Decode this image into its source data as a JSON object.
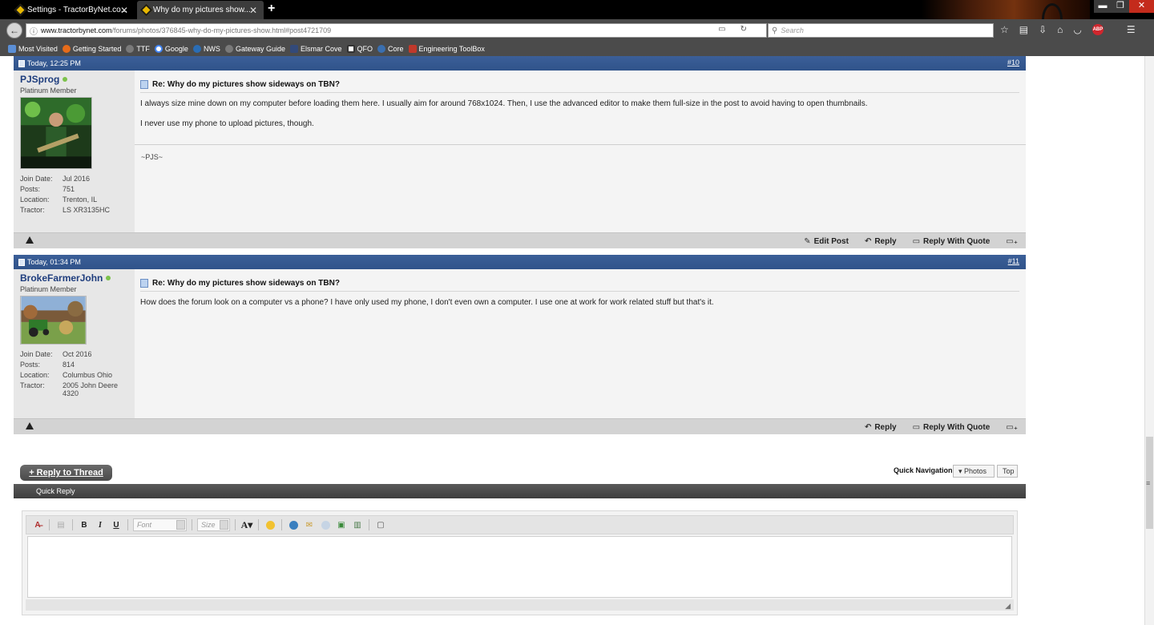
{
  "browser": {
    "tabs": [
      {
        "title": "Settings - TractorByNet.co..."
      },
      {
        "title": "Why do my pictures show..."
      }
    ],
    "url_domain": "www.tractorbynet.com",
    "url_path": "/forums/photos/376845-why-do-my-pictures-show.html#post4721709",
    "search_placeholder": "Search",
    "bookmarks": [
      {
        "label": "Most Visited",
        "color": "#5b8fd6"
      },
      {
        "label": "Getting Started",
        "color": "#e66b1a"
      },
      {
        "label": "TTF",
        "color": "#7a7a7a"
      },
      {
        "label": "Google",
        "color": "#4285f4"
      },
      {
        "label": "NWS",
        "color": "#2a6db5"
      },
      {
        "label": "Gateway Guide",
        "color": "#7a7a7a"
      },
      {
        "label": "Elsmar Cove",
        "color": "#334a7a"
      },
      {
        "label": "QFO",
        "color": "#ffffff"
      },
      {
        "label": "Core",
        "color": "#3a6fb0"
      },
      {
        "label": "Engineering ToolBox",
        "color": "#c0392b"
      }
    ]
  },
  "posts": [
    {
      "date": "Today, 12:25 PM",
      "number": "#10",
      "username": "PJSprog",
      "user_title": "Platinum Member",
      "info": [
        {
          "k": "Join Date:",
          "v": "Jul 2016"
        },
        {
          "k": "Posts:",
          "v": "751"
        },
        {
          "k": "Location:",
          "v": "Trenton, IL"
        },
        {
          "k": "Tractor:",
          "v": "LS XR3135HC"
        }
      ],
      "title": "Re: Why do my pictures show sideways on TBN?",
      "paragraphs": [
        "I always size mine down on my computer before loading them here. I usually aim for around 768x1024. Then, I use the advanced editor to make them full-size in the post to avoid having to open thumbnails.",
        "I never use my phone to upload pictures, though."
      ],
      "signature": "~PJS~",
      "actions": {
        "edit": "Edit Post",
        "reply": "Reply",
        "quote": "Reply With Quote"
      }
    },
    {
      "date": "Today, 01:34 PM",
      "number": "#11",
      "username": "BrokeFarmerJohn",
      "user_title": "Platinum Member",
      "info": [
        {
          "k": "Join Date:",
          "v": "Oct 2016"
        },
        {
          "k": "Posts:",
          "v": "814"
        },
        {
          "k": "Location:",
          "v": "Columbus Ohio"
        },
        {
          "k": "Tractor:",
          "v": "2005 John Deere 4320"
        }
      ],
      "title": "Re: Why do my pictures show sideways on TBN?",
      "paragraphs": [
        "How does the forum look on a computer vs a phone? I have only used my phone, I don't even own a computer. I use one at work for work related stuff but that's it."
      ],
      "actions": {
        "reply": "Reply",
        "quote": "Reply With Quote"
      }
    }
  ],
  "thread": {
    "reply_button": "+ Reply to Thread",
    "quick_nav_label": "Quick Navigation",
    "photos_button": "▾ Photos",
    "top_button": "Top"
  },
  "quick_reply": {
    "title": "Quick Reply",
    "font_placeholder": "Font",
    "size_placeholder": "Size"
  }
}
